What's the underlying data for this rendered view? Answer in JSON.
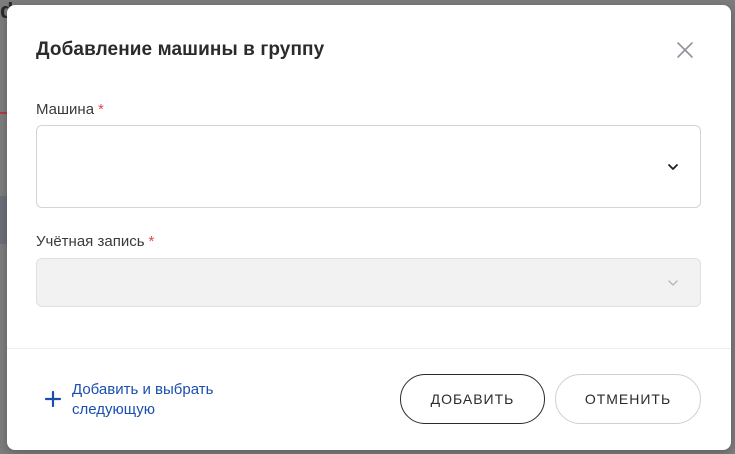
{
  "background": {
    "title_fragment": "d"
  },
  "dialog": {
    "title": "Добавление машины в группу",
    "fields": {
      "machine": {
        "label": "Машина",
        "required_mark": "*",
        "value": ""
      },
      "account": {
        "label": "Учётная запись",
        "required_mark": "*",
        "value": "",
        "disabled": true
      }
    },
    "footer": {
      "add_next_label": "Добавить и выбрать следующую",
      "add_button": "ДОБАВИТЬ",
      "cancel_button": "ОТМЕНИТЬ"
    }
  },
  "colors": {
    "accent_link": "#1a4fb0",
    "required": "#e24b4b",
    "overlay": "#7d7d7d"
  },
  "icons": {
    "close": "close-icon",
    "chevron": "chevron-down-icon",
    "plus": "plus-icon"
  }
}
